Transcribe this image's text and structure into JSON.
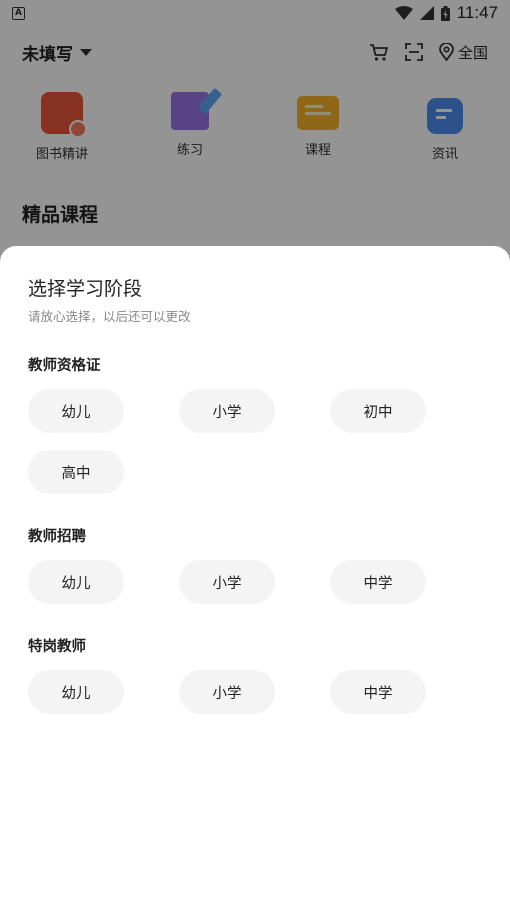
{
  "status_bar": {
    "left_badge": "A",
    "time": "11:47"
  },
  "header": {
    "location_name": "未填写",
    "region": "全国"
  },
  "categories": [
    {
      "label": "图书精讲",
      "icon": "book-icon"
    },
    {
      "label": "练习",
      "icon": "practice-icon"
    },
    {
      "label": "课程",
      "icon": "course-icon"
    },
    {
      "label": "资讯",
      "icon": "news-icon"
    }
  ],
  "section_title": "精品课程",
  "sheet": {
    "title": "选择学习阶段",
    "subtitle": "请放心选择，以后还可以更改",
    "groups": [
      {
        "label": "教师资格证",
        "options": [
          "幼儿",
          "小学",
          "初中",
          "高中"
        ]
      },
      {
        "label": "教师招聘",
        "options": [
          "幼儿",
          "小学",
          "中学"
        ]
      },
      {
        "label": "特岗教师",
        "options": [
          "幼儿",
          "小学",
          "中学"
        ]
      }
    ]
  },
  "colors": {
    "pill_bg": "#f4f4f4",
    "overlay": "rgba(0,0,0,0.42)"
  }
}
